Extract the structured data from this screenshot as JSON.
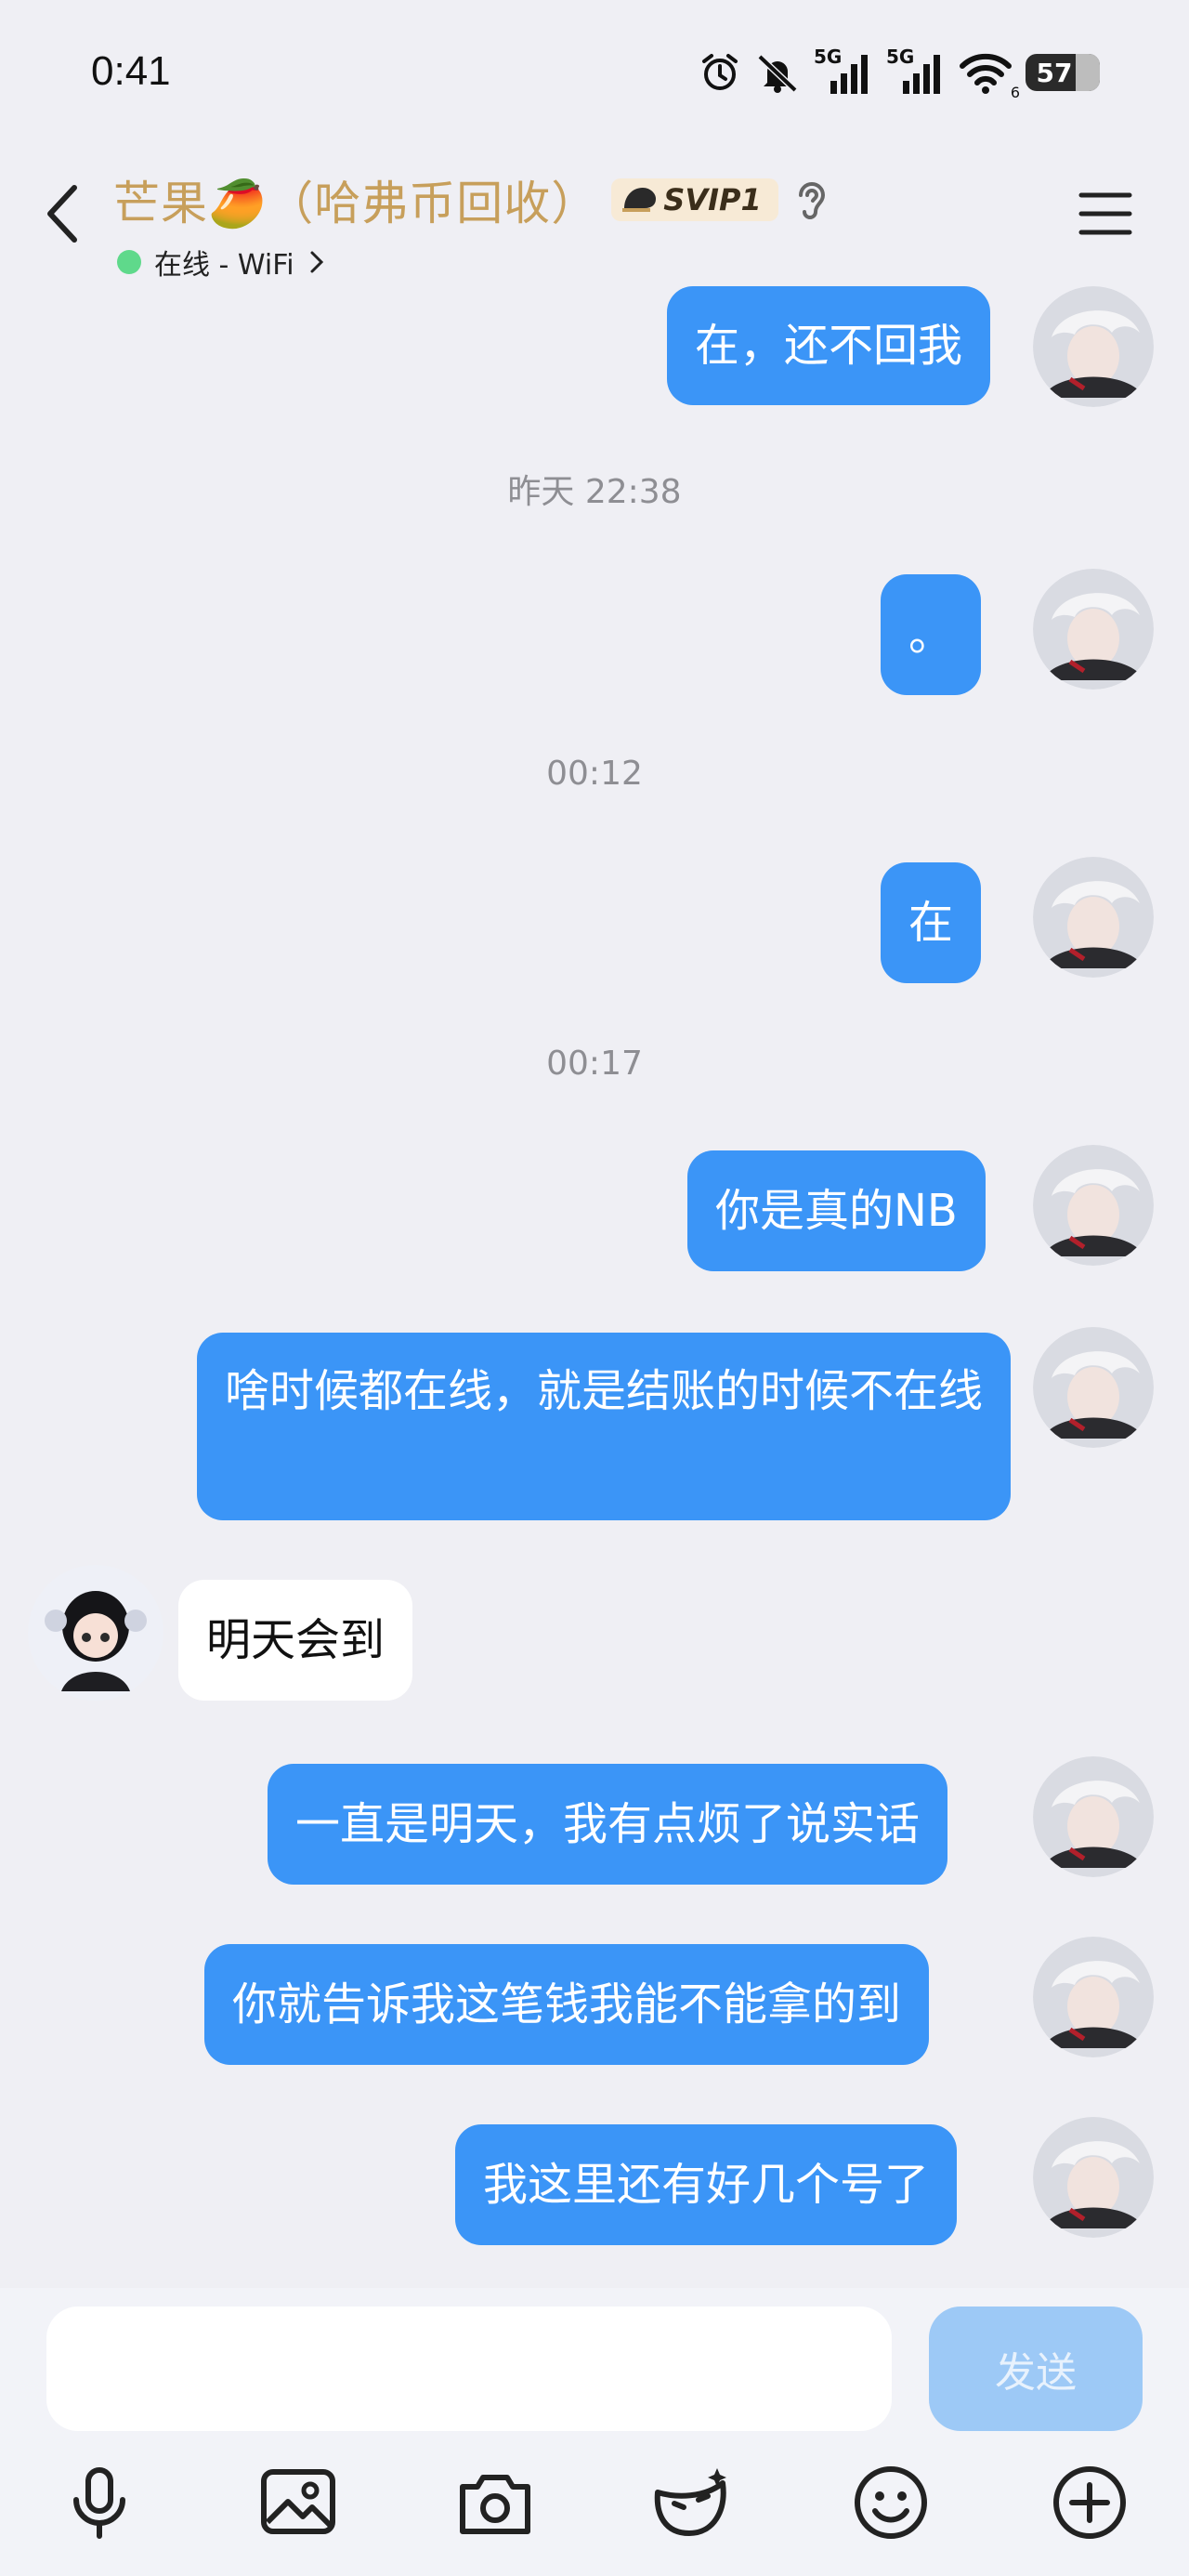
{
  "status_bar": {
    "time": "0:41",
    "signal1": "5G",
    "signal2": "5G",
    "wifi_level": "6",
    "battery": "57"
  },
  "header": {
    "title": "芒果🥭（哈弗币回收）",
    "badge": "SVIP1",
    "status_text": "在线 - WiFi",
    "icons": [
      "back-icon",
      "ear-icon",
      "menu-icon"
    ]
  },
  "messages": [
    {
      "dir": "out",
      "text": "在，还不回我"
    },
    {
      "ts": "昨天 22:38"
    },
    {
      "dir": "out",
      "text": "。"
    },
    {
      "ts": "00:12"
    },
    {
      "dir": "out",
      "text": "在"
    },
    {
      "ts": "00:17"
    },
    {
      "dir": "out",
      "text": "你是真的NB"
    },
    {
      "dir": "out",
      "text": "啥时候都在线，就是结账的时候不在线"
    },
    {
      "dir": "in",
      "text": "明天会到"
    },
    {
      "dir": "out",
      "text": "一直是明天，我有点烦了说实话"
    },
    {
      "dir": "out",
      "text": "你就告诉我这笔钱我能不能拿的到"
    },
    {
      "dir": "out",
      "text": "我这里还有好几个号了"
    }
  ],
  "composer": {
    "input_value": "",
    "send_label": "发送",
    "tools": [
      "mic-icon",
      "image-icon",
      "camera-icon",
      "mask-icon",
      "emoji-icon",
      "plus-icon"
    ]
  },
  "colors": {
    "outgoing_bubble": "#3b95f7",
    "title_gold": "#c79f5b",
    "online_dot": "#5fd98b",
    "send_disabled": "#9dc9f6"
  }
}
